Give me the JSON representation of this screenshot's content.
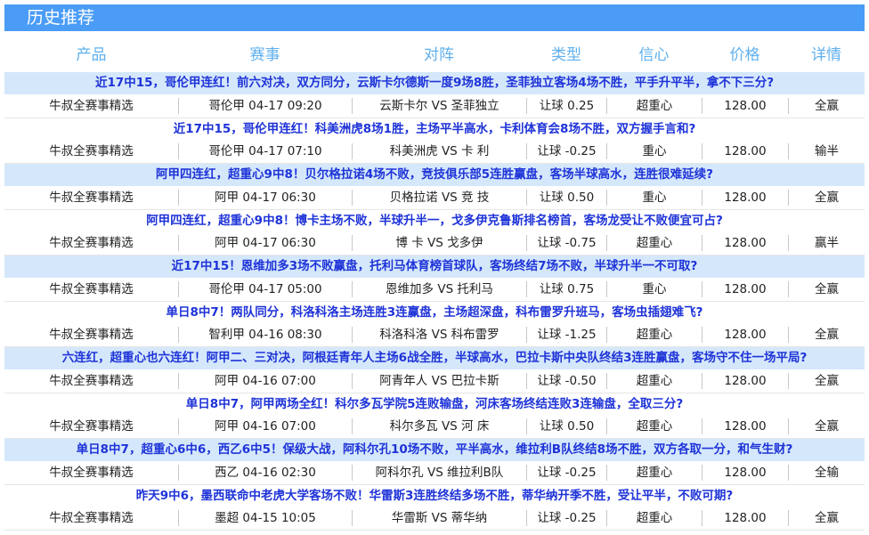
{
  "title": "历史推荐",
  "headers": [
    "产品",
    "赛事",
    "对阵",
    "类型",
    "信心",
    "价格",
    "详情"
  ],
  "rows": [
    {
      "headline": "近17中15，哥伦甲连红！前六对决，双方同分，云斯卡尔德斯一度9场8胜，圣菲独立客场4场不胜，平手升平半，拿不下三分?",
      "product": "牛叔全赛事精选",
      "event": "哥伦甲 04-17 09:20",
      "match": "云斯卡尔 VS 圣菲独立",
      "type": "让球 0.25",
      "confidence": "超重心",
      "price": "128.00",
      "result": "全赢"
    },
    {
      "headline": "近17中15，哥伦甲连红！科美洲虎8场1胜，主场平半高水，卡利体育会8场不胜，双方握手言和?",
      "product": "牛叔全赛事精选",
      "event": "哥伦甲 04-17 07:10",
      "match": "科美洲虎 VS 卡 利",
      "type": "让球 -0.25",
      "confidence": "重心",
      "price": "128.00",
      "result": "输半"
    },
    {
      "headline": "阿甲四连红，超重心9中8！贝尔格拉诺4场不败，竞技俱乐部5连胜赢盘，客场半球高水，连胜很难延续?",
      "product": "牛叔全赛事精选",
      "event": "阿甲 04-17 06:30",
      "match": "贝格拉诺 VS 竞 技",
      "type": "让球 0.50",
      "confidence": "重心",
      "price": "128.00",
      "result": "全赢"
    },
    {
      "headline": "阿甲四连红，超重心9中8！博卡主场不败，半球升半一，戈多伊克鲁斯排名榜首，客场龙受让不败便宜可占?",
      "product": "牛叔全赛事精选",
      "event": "阿甲 04-17 06:30",
      "match": "博 卡 VS 戈多伊",
      "type": "让球 -0.75",
      "confidence": "超重心",
      "price": "128.00",
      "result": "赢半"
    },
    {
      "headline": "近17中15！恩维加多3场不败赢盘，托利马体育榜首球队，客场终结7场不败，半球升半一不可取?",
      "product": "牛叔全赛事精选",
      "event": "哥伦甲 04-17 05:00",
      "match": "恩维加多 VS 托利马",
      "type": "让球 0.75",
      "confidence": "重心",
      "price": "128.00",
      "result": "全赢"
    },
    {
      "headline": "单日8中7！两队同分，科洛科洛主场连胜3连赢盘，主场超深盘，科布雷罗升班马，客场虫插翅难飞?",
      "product": "牛叔全赛事精选",
      "event": "智利甲 04-16 08:30",
      "match": "科洛科洛 VS 科布雷罗",
      "type": "让球 -1.25",
      "confidence": "超重心",
      "price": "128.00",
      "result": "全赢"
    },
    {
      "headline": "六连红，超重心也六连红！阿甲二、三对决，阿根廷青年人主场6战全胜，半球高水，巴拉卡斯中央队终结3连胜赢盘，客场守不住一场平局?",
      "product": "牛叔全赛事精选",
      "event": "阿甲 04-16 07:00",
      "match": "阿青年人 VS 巴拉卡斯",
      "type": "让球 -0.50",
      "confidence": "超重心",
      "price": "128.00",
      "result": "全赢"
    },
    {
      "headline": "单日8中7，阿甲两场全红！科尔多瓦学院5连败输盘，河床客场终结连败3连输盘，全取三分?",
      "product": "牛叔全赛事精选",
      "event": "阿甲 04-16 07:00",
      "match": "科尔多瓦 VS 河 床",
      "type": "让球 0.50",
      "confidence": "超重心",
      "price": "128.00",
      "result": "全赢"
    },
    {
      "headline": "单日8中7，超重心6中6，西乙6中5！保级大战，阿科尔孔10场不败，平半高水，维拉利B队终结8场不胜，双方各取一分，和气生财?",
      "product": "牛叔全赛事精选",
      "event": "西乙 04-16 02:30",
      "match": "阿科尔孔 VS 维拉利B队",
      "type": "让球 -0.25",
      "confidence": "超重心",
      "price": "128.00",
      "result": "全输"
    },
    {
      "headline": "昨天9中6，墨西联命中老虎大学客场不败！华雷斯3连胜终结多场不胜，蒂华纳开季不胜，受让平半，不败可期?",
      "product": "牛叔全赛事精选",
      "event": "墨超 04-15 10:05",
      "match": "华雷斯 VS 蒂华纳",
      "type": "让球 -0.25",
      "confidence": "超重心",
      "price": "128.00",
      "result": "全赢"
    }
  ]
}
